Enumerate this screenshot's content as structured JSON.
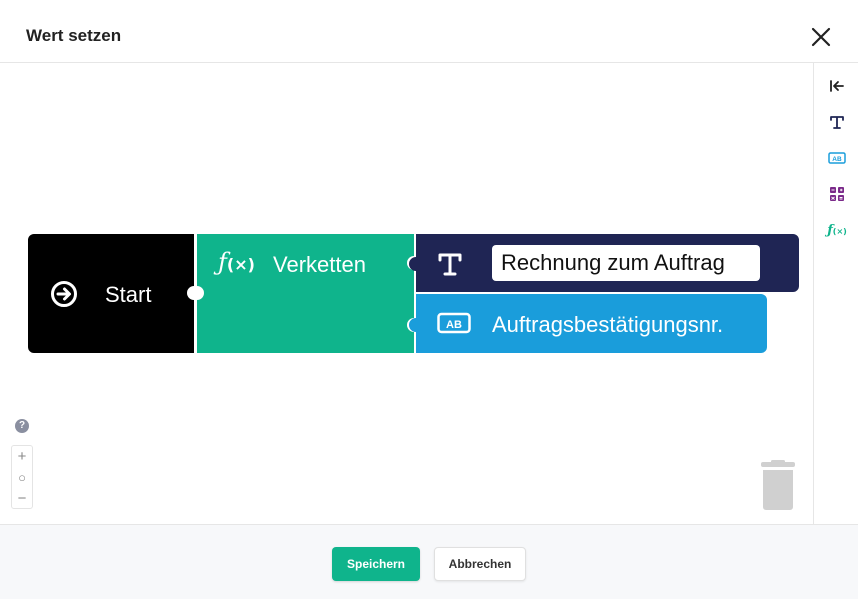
{
  "dialog": {
    "title": "Wert setzen"
  },
  "blocks": {
    "start_label": "Start",
    "concat_label": "Verketten",
    "text_value": "Rechnung zum Auftrag",
    "field_label": "Auftragsbestätigungsnr."
  },
  "footer": {
    "save_label": "Speichern",
    "cancel_label": "Abbrechen"
  },
  "zoom": {
    "plus": "+",
    "reset": "○",
    "minus": "−"
  },
  "help": {
    "label": "?"
  },
  "colors": {
    "start": "#000000",
    "concat": "#0fb48c",
    "text": "#1f2554",
    "field": "#1a9ddb",
    "toolbox_variable": "#7b2a8a"
  }
}
